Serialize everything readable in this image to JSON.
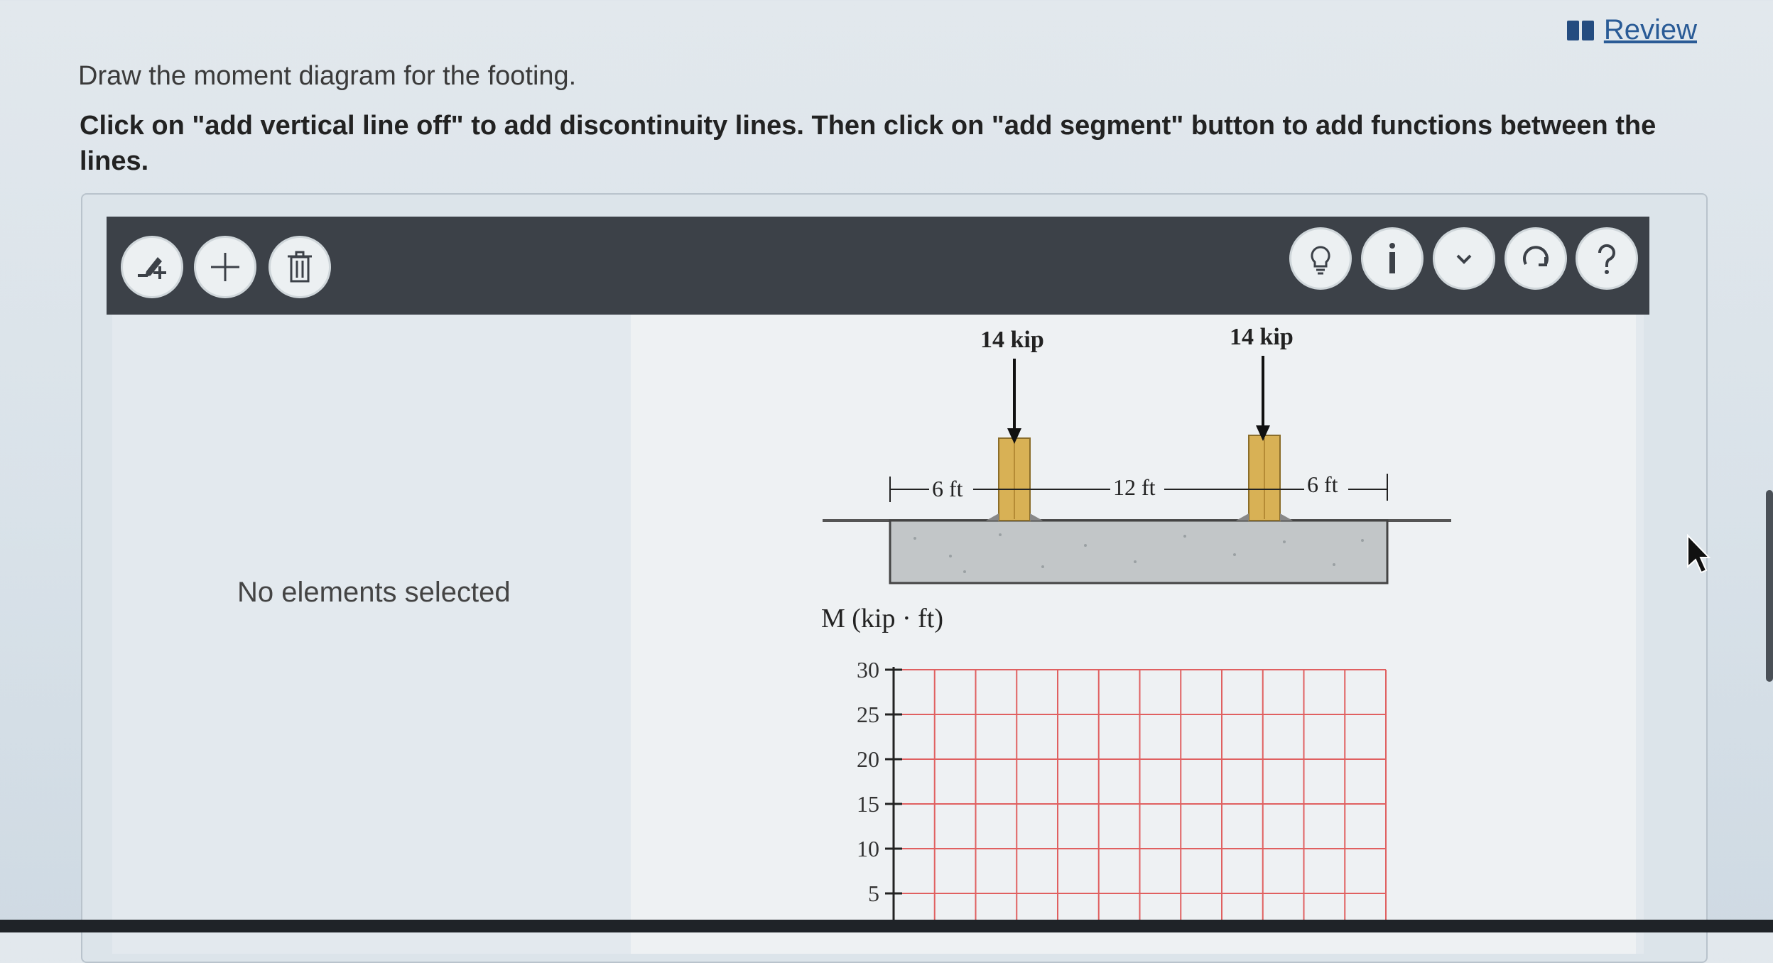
{
  "header": {
    "review_label": "Review",
    "icons": {
      "review": "book-icon"
    }
  },
  "question": {
    "prompt": "Draw the moment diagram for the footing.",
    "instruction": "Click on \"add vertical line off\" to add discontinuity lines. Then click on \"add segment\" button to add functions between the lines."
  },
  "toolbar": {
    "left_tools": [
      {
        "name": "add-vertical-line-tool",
        "icon": "pen-plus-icon"
      },
      {
        "name": "add-segment-tool",
        "icon": "plus-icon"
      },
      {
        "name": "delete-tool",
        "icon": "trash-icon"
      }
    ],
    "right_tools": [
      {
        "name": "hint-button",
        "icon": "lightbulb-icon"
      },
      {
        "name": "info-button",
        "icon": "info-icon"
      },
      {
        "name": "collapse-button",
        "icon": "chevron-down-icon"
      },
      {
        "name": "reset-button",
        "icon": "reset-icon"
      },
      {
        "name": "help-button",
        "icon": "question-icon"
      }
    ]
  },
  "sidebar": {
    "status": "No elements selected"
  },
  "figure": {
    "load_left": "14 kip",
    "load_right": "14 kip",
    "dim_left": "6 ft",
    "dim_mid": "12 ft",
    "dim_right": "6 ft",
    "colors": {
      "column": "#d8b155",
      "footing": "#c2c6c8",
      "grid": "#e06060"
    }
  },
  "chart_data": {
    "type": "line",
    "ylabel": "M (kip · ft)",
    "y_ticks": [
      30,
      25,
      20,
      15,
      10,
      5
    ],
    "grid": true,
    "series": []
  }
}
